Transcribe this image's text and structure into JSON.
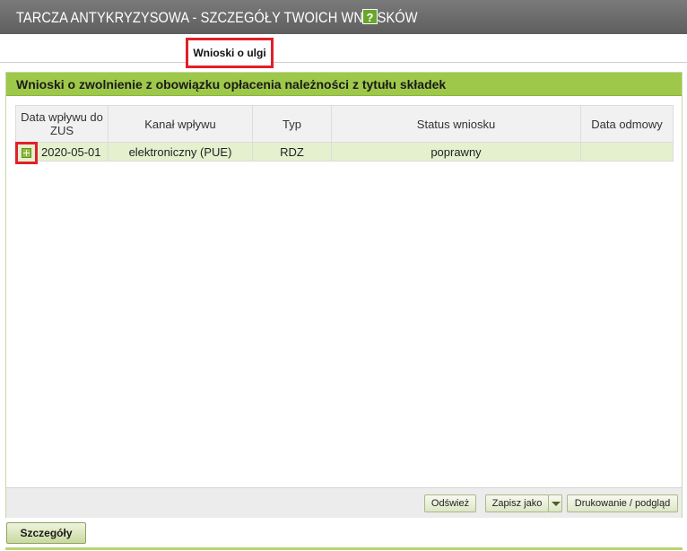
{
  "window": {
    "title": "TARCZA ANTYKRYZYSOWA - SZCZEGÓŁY TWOICH WNIOSKÓW",
    "help_glyph": "?"
  },
  "tabs": [
    {
      "label": "Wnioski o ulgi",
      "active": true
    }
  ],
  "panel": {
    "title": "Wnioski o zwolnienie z obowiązku opłacenia należności z tytułu składek"
  },
  "table": {
    "columns": [
      "Data wpływu do ZUS",
      "Kanał wpływu",
      "Typ",
      "Status wniosku",
      "Data odmowy"
    ],
    "rows": [
      {
        "date": "2020-05-01",
        "channel": "elektroniczny (PUE)",
        "type": "RDZ",
        "status": "poprawny",
        "refusal_date": ""
      }
    ]
  },
  "toolbar": {
    "refresh": "Odśwież",
    "save_as": "Zapisz jako",
    "print": "Drukowanie / podgląd"
  },
  "footer": {
    "details": "Szczegóły"
  },
  "colors": {
    "title_bar": "#6a6a6a",
    "panel_header": "#9ec84a",
    "row_bg": "#e5f0cf",
    "highlight": "#e0202a"
  }
}
